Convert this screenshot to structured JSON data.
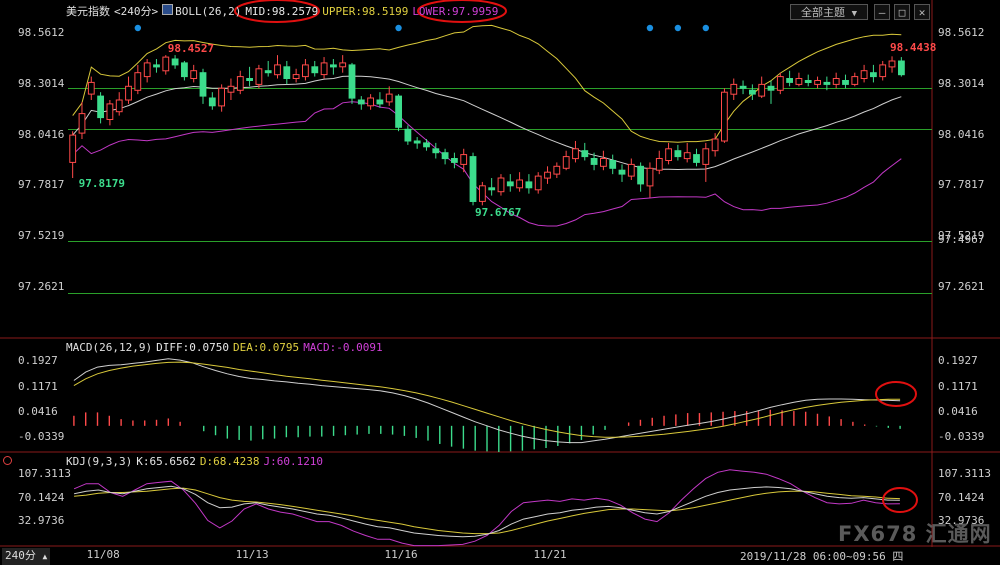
{
  "header": {
    "symbol": "美元指数",
    "period_tag": "<240分>",
    "boll": "BOLL(26,2)",
    "mid": "MID:98.2579",
    "upper": "UPPER:98.5199",
    "lower": "LOWER:97.9959",
    "theme_button": "全部主题",
    "theme_arrow": "▼"
  },
  "macd_header": {
    "name": "MACD(26,12,9)",
    "diff": "DIFF:0.0750",
    "dea": "DEA:0.0795",
    "macd": "MACD:-0.0091"
  },
  "kdj_header": {
    "name": "KDJ(9,3,3)",
    "k": "K:65.6562",
    "d": "D:68.4238",
    "j": "J:60.1210"
  },
  "footer": {
    "period": "240分",
    "timestamp": "2019/11/28 06:00~09:56 四",
    "watermark": "FX678 汇通网"
  },
  "colors": {
    "up": "#ff4a4a",
    "down": "#3cdc8c",
    "mid_line": "#cfcfcf",
    "upper_line": "#d8c83a",
    "lower_line": "#c238c6",
    "level_line": "#2aa02a",
    "annotation": "#e01010"
  },
  "chart_data": [
    {
      "type": "candlestick",
      "title": "美元指数",
      "y_ticks": [
        "98.5612",
        "98.3014",
        "98.0416",
        "97.7817",
        "97.5219",
        "97.2621"
      ],
      "ylim": [
        97.0,
        98.63
      ],
      "x_ticks": [
        "11/08",
        "11/13",
        "11/16",
        "11/21"
      ],
      "level_lines": [
        98.28,
        98.07,
        97.4967,
        97.23
      ],
      "level_label": "97.4967",
      "highest_label": "98.4527",
      "lowest_label": "97.6767",
      "first_low_label": "97.8179",
      "last_high_label": "98.4438",
      "signal_dots_count": 5,
      "candles": [
        [
          97.9,
          98.04,
          98.06,
          97.82
        ],
        [
          98.05,
          98.15,
          98.21,
          98.02
        ],
        [
          98.25,
          98.31,
          98.34,
          98.22
        ],
        [
          98.24,
          98.13,
          98.26,
          98.1
        ],
        [
          98.12,
          98.2,
          98.22,
          98.09
        ],
        [
          98.16,
          98.22,
          98.26,
          98.14
        ],
        [
          98.22,
          98.29,
          98.34,
          98.2
        ],
        [
          98.27,
          98.36,
          98.4,
          98.25
        ],
        [
          98.34,
          98.41,
          98.43,
          98.31
        ],
        [
          98.4,
          98.39,
          98.43,
          98.36
        ],
        [
          98.37,
          98.44,
          98.45,
          98.35
        ],
        [
          98.43,
          98.4,
          98.45,
          98.38
        ],
        [
          98.41,
          98.34,
          98.42,
          98.32
        ],
        [
          98.33,
          98.37,
          98.4,
          98.31
        ],
        [
          98.36,
          98.24,
          98.38,
          98.2
        ],
        [
          98.23,
          98.19,
          98.26,
          98.17
        ],
        [
          98.19,
          98.28,
          98.3,
          98.16
        ],
        [
          98.26,
          98.29,
          98.33,
          98.22
        ],
        [
          98.27,
          98.34,
          98.37,
          98.25
        ],
        [
          98.33,
          98.32,
          98.39,
          98.29
        ],
        [
          98.3,
          98.38,
          98.4,
          98.28
        ],
        [
          98.37,
          98.36,
          98.42,
          98.34
        ],
        [
          98.35,
          98.4,
          98.45,
          98.33
        ],
        [
          98.39,
          98.33,
          98.42,
          98.3
        ],
        [
          98.33,
          98.35,
          98.38,
          98.31
        ],
        [
          98.34,
          98.4,
          98.43,
          98.32
        ],
        [
          98.39,
          98.36,
          98.42,
          98.34
        ],
        [
          98.35,
          98.41,
          98.44,
          98.33
        ],
        [
          98.4,
          98.39,
          98.43,
          98.35
        ],
        [
          98.39,
          98.41,
          98.45,
          98.36
        ],
        [
          98.4,
          98.23,
          98.41,
          98.2
        ],
        [
          98.22,
          98.2,
          98.24,
          98.17
        ],
        [
          98.19,
          98.23,
          98.25,
          98.17
        ],
        [
          98.22,
          98.2,
          98.26,
          98.18
        ],
        [
          98.21,
          98.25,
          98.29,
          98.19
        ],
        [
          98.24,
          98.08,
          98.25,
          98.06
        ],
        [
          98.07,
          98.01,
          98.09,
          97.99
        ],
        [
          98.01,
          98.0,
          98.03,
          97.97
        ],
        [
          98.0,
          97.98,
          98.02,
          97.96
        ],
        [
          97.97,
          97.95,
          98.0,
          97.92
        ],
        [
          97.95,
          97.92,
          97.97,
          97.89
        ],
        [
          97.92,
          97.9,
          97.95,
          97.87
        ],
        [
          97.89,
          97.94,
          97.97,
          97.85
        ],
        [
          97.93,
          97.7,
          97.95,
          97.68
        ],
        [
          97.7,
          97.78,
          97.8,
          97.68
        ],
        [
          97.77,
          97.76,
          97.82,
          97.73
        ],
        [
          97.75,
          97.82,
          97.84,
          97.73
        ],
        [
          97.8,
          97.78,
          97.84,
          97.75
        ],
        [
          97.77,
          97.81,
          97.85,
          97.75
        ],
        [
          97.8,
          97.77,
          97.84,
          97.74
        ],
        [
          97.76,
          97.83,
          97.85,
          97.74
        ],
        [
          97.82,
          97.85,
          97.88,
          97.79
        ],
        [
          97.84,
          97.88,
          97.9,
          97.82
        ],
        [
          97.87,
          97.93,
          97.96,
          97.86
        ],
        [
          97.92,
          97.97,
          98.01,
          97.9
        ],
        [
          97.96,
          97.93,
          98.0,
          97.91
        ],
        [
          97.92,
          97.89,
          97.95,
          97.86
        ],
        [
          97.88,
          97.92,
          97.96,
          97.86
        ],
        [
          97.91,
          97.87,
          97.94,
          97.84
        ],
        [
          97.86,
          97.84,
          97.89,
          97.8
        ],
        [
          97.83,
          97.89,
          97.92,
          97.81
        ],
        [
          97.88,
          97.79,
          97.9,
          97.75
        ],
        [
          97.78,
          97.87,
          97.9,
          97.72
        ],
        [
          97.86,
          97.92,
          97.96,
          97.84
        ],
        [
          97.91,
          97.97,
          98.0,
          97.89
        ],
        [
          97.96,
          97.93,
          97.99,
          97.91
        ],
        [
          97.92,
          97.95,
          98.0,
          97.9
        ],
        [
          97.94,
          97.9,
          97.97,
          97.88
        ],
        [
          97.89,
          97.97,
          98.0,
          97.8
        ],
        [
          97.96,
          98.02,
          98.05,
          97.93
        ],
        [
          98.01,
          98.26,
          98.28,
          98.0
        ],
        [
          98.25,
          98.3,
          98.33,
          98.22
        ],
        [
          98.29,
          98.28,
          98.32,
          98.25
        ],
        [
          98.27,
          98.25,
          98.3,
          98.22
        ],
        [
          98.24,
          98.3,
          98.34,
          98.23
        ],
        [
          98.29,
          98.27,
          98.32,
          98.2
        ],
        [
          98.27,
          98.34,
          98.36,
          98.25
        ],
        [
          98.33,
          98.31,
          98.37,
          98.29
        ],
        [
          98.3,
          98.33,
          98.36,
          98.29
        ],
        [
          98.32,
          98.31,
          98.35,
          98.29
        ],
        [
          98.3,
          98.32,
          98.34,
          98.28
        ],
        [
          98.31,
          98.3,
          98.34,
          98.27
        ],
        [
          98.3,
          98.33,
          98.36,
          98.28
        ],
        [
          98.32,
          98.3,
          98.35,
          98.28
        ],
        [
          98.3,
          98.34,
          98.36,
          98.29
        ],
        [
          98.33,
          98.37,
          98.4,
          98.31
        ],
        [
          98.36,
          98.34,
          98.4,
          98.31
        ],
        [
          98.34,
          98.4,
          98.42,
          98.32
        ],
        [
          98.39,
          98.42,
          98.4438,
          98.36
        ],
        [
          98.42,
          98.35,
          98.44,
          98.34
        ]
      ]
    },
    {
      "type": "line",
      "title": "MACD(26,12,9)",
      "y_ticks": [
        "0.1927",
        "0.1171",
        "0.0416",
        "-0.0339"
      ],
      "ylim": [
        -0.072,
        0.22
      ],
      "series": [
        {
          "name": "DIFF",
          "values": [
            0.135,
            0.16,
            0.175,
            0.18,
            0.182,
            0.186,
            0.19,
            0.195,
            0.2,
            0.196,
            0.188,
            0.176,
            0.165,
            0.155,
            0.147,
            0.141,
            0.138,
            0.134,
            0.131,
            0.127,
            0.124,
            0.12,
            0.117,
            0.114,
            0.111,
            0.108,
            0.104,
            0.098,
            0.09,
            0.08,
            0.068,
            0.054,
            0.04,
            0.026,
            0.012,
            0.0,
            -0.012,
            -0.022,
            -0.031,
            -0.038,
            -0.044,
            -0.048,
            -0.05,
            -0.05,
            -0.045,
            -0.04,
            -0.034,
            -0.028,
            -0.022,
            -0.016,
            -0.01,
            -0.004,
            0.002,
            0.007,
            0.013,
            0.02,
            0.028,
            0.036,
            0.045,
            0.055,
            0.063,
            0.07,
            0.076,
            0.079,
            0.08,
            0.08,
            0.079,
            0.078,
            0.077,
            0.076,
            0.075
          ]
        },
        {
          "name": "DEA",
          "values": [
            0.12,
            0.14,
            0.155,
            0.165,
            0.172,
            0.178,
            0.182,
            0.186,
            0.189,
            0.19,
            0.188,
            0.184,
            0.179,
            0.174,
            0.168,
            0.163,
            0.158,
            0.153,
            0.148,
            0.144,
            0.14,
            0.136,
            0.132,
            0.128,
            0.124,
            0.12,
            0.116,
            0.111,
            0.105,
            0.098,
            0.09,
            0.081,
            0.071,
            0.06,
            0.049,
            0.038,
            0.027,
            0.016,
            0.006,
            -0.003,
            -0.011,
            -0.018,
            -0.024,
            -0.029,
            -0.032,
            -0.034,
            -0.034,
            -0.033,
            -0.031,
            -0.028,
            -0.025,
            -0.021,
            -0.017,
            -0.012,
            -0.007,
            -0.001,
            0.006,
            0.014,
            0.022,
            0.031,
            0.04,
            0.048,
            0.055,
            0.061,
            0.066,
            0.07,
            0.073,
            0.076,
            0.078,
            0.079,
            0.0795
          ]
        },
        {
          "name": "MACD",
          "values": [
            0.03,
            0.04,
            0.04,
            0.03,
            0.02,
            0.016,
            0.016,
            0.018,
            0.022,
            0.012,
            0.0,
            -0.016,
            -0.028,
            -0.038,
            -0.042,
            -0.044,
            -0.04,
            -0.038,
            -0.034,
            -0.034,
            -0.032,
            -0.032,
            -0.03,
            -0.028,
            -0.026,
            -0.024,
            -0.024,
            -0.026,
            -0.03,
            -0.036,
            -0.044,
            -0.054,
            -0.062,
            -0.068,
            -0.074,
            -0.076,
            -0.078,
            -0.076,
            -0.074,
            -0.07,
            -0.066,
            -0.06,
            -0.052,
            -0.042,
            -0.026,
            -0.012,
            0.0,
            0.01,
            0.018,
            0.024,
            0.03,
            0.034,
            0.038,
            0.038,
            0.04,
            0.042,
            0.044,
            0.044,
            0.046,
            0.048,
            0.046,
            0.044,
            0.042,
            0.036,
            0.028,
            0.02,
            0.012,
            0.004,
            -0.002,
            -0.006,
            -0.009
          ]
        }
      ]
    },
    {
      "type": "line",
      "title": "KDJ(9,3,3)",
      "y_ticks": [
        "107.3113",
        "70.1424",
        "32.9736"
      ],
      "ylim": [
        -5,
        120
      ],
      "series": [
        {
          "name": "K",
          "values": [
            76,
            80,
            82,
            78,
            76,
            80,
            84,
            86,
            88,
            84,
            75,
            62,
            54,
            55,
            60,
            62,
            58,
            55,
            52,
            48,
            44,
            42,
            38,
            33,
            28,
            24,
            22,
            18,
            14,
            12,
            10,
            9,
            8,
            9,
            12,
            18,
            28,
            36,
            40,
            44,
            46,
            50,
            52,
            55,
            56,
            54,
            50,
            46,
            44,
            48,
            56,
            64,
            72,
            78,
            82,
            84,
            86,
            87,
            86,
            84,
            80,
            76,
            72,
            70,
            69,
            70,
            68,
            66,
            65.6562
          ]
        },
        {
          "name": "D",
          "values": [
            72,
            74,
            77,
            78,
            78,
            79,
            80,
            82,
            84,
            85,
            82,
            76,
            70,
            66,
            64,
            63,
            61,
            59,
            56,
            53,
            50,
            47,
            44,
            41,
            37,
            34,
            31,
            28,
            24,
            21,
            18,
            16,
            14,
            13,
            13,
            14,
            18,
            23,
            28,
            33,
            37,
            41,
            45,
            48,
            51,
            52,
            52,
            51,
            50,
            49,
            51,
            54,
            58,
            62,
            66,
            70,
            74,
            77,
            79,
            80,
            80,
            79,
            77,
            75,
            73,
            72,
            71,
            69,
            68.4238
          ]
        },
        {
          "name": "J",
          "values": [
            84,
            92,
            92,
            78,
            72,
            82,
            92,
            94,
            96,
            82,
            61,
            34,
            22,
            33,
            52,
            60,
            52,
            47,
            44,
            38,
            32,
            32,
            26,
            17,
            10,
            4,
            4,
            -2,
            -6,
            -6,
            -6,
            -5,
            -4,
            1,
            10,
            26,
            48,
            62,
            64,
            66,
            64,
            68,
            66,
            69,
            66,
            58,
            46,
            36,
            32,
            46,
            66,
            84,
            100,
            110,
            114,
            112,
            110,
            107,
            100,
            92,
            80,
            70,
            62,
            60,
            61,
            66,
            62,
            60,
            60.121
          ]
        }
      ]
    }
  ]
}
